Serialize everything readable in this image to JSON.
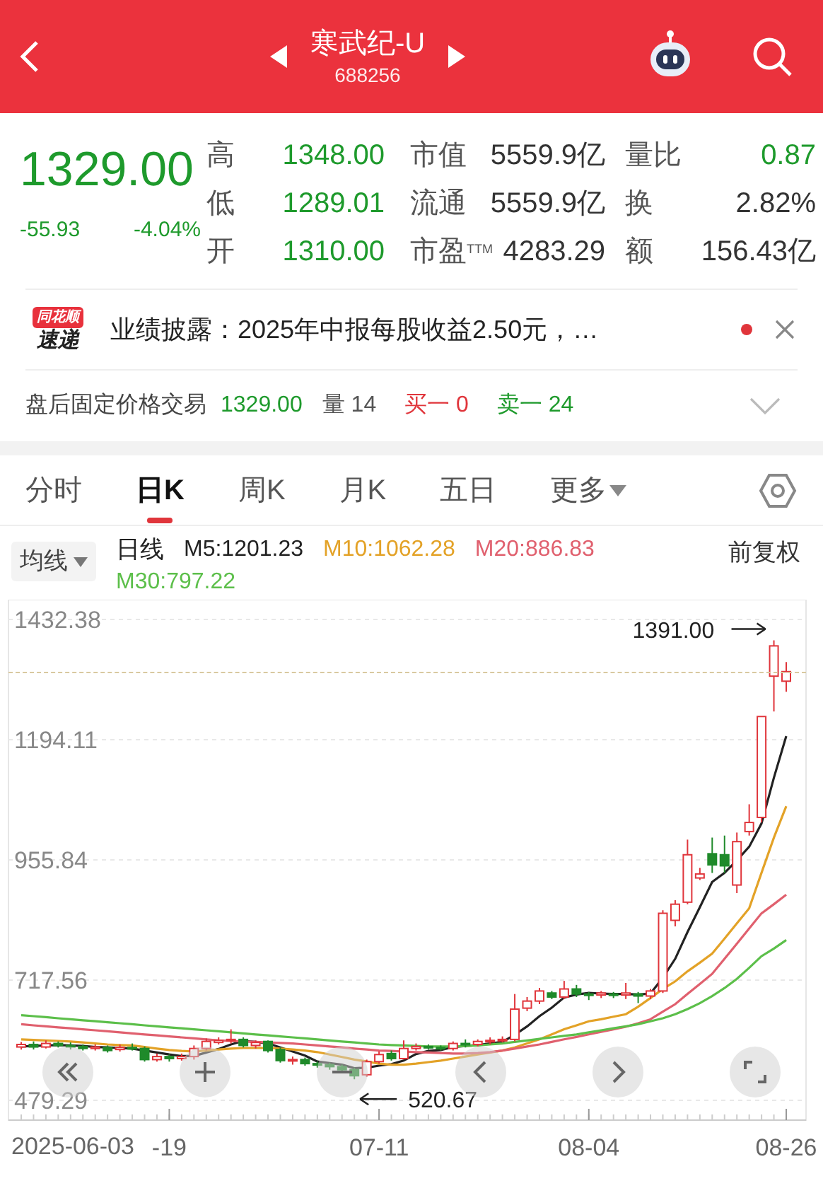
{
  "header": {
    "title": "寒武纪-U",
    "code": "688256"
  },
  "quote": {
    "price": "1329.00",
    "change": "-55.93",
    "change_pct": "-4.04%",
    "color": "#1e9a2c"
  },
  "stats": [
    [
      {
        "label": "高",
        "value": "1348.00",
        "color": "#1e9a2c"
      },
      {
        "label": "市值",
        "value": "5559.9亿",
        "color": "#333333"
      },
      {
        "label": "量比",
        "value": "0.87",
        "color": "#1e9a2c"
      }
    ],
    [
      {
        "label": "低",
        "value": "1289.01",
        "color": "#1e9a2c"
      },
      {
        "label": "流通",
        "value": "5559.9亿",
        "color": "#333333"
      },
      {
        "label": "换",
        "value": "2.82%",
        "color": "#333333"
      }
    ],
    [
      {
        "label": "开",
        "value": "1310.00",
        "color": "#1e9a2c"
      },
      {
        "label": "市盈$^{TTM}$",
        "value": "4283.29",
        "color": "#333333"
      },
      {
        "label": "额",
        "value": "156.43亿",
        "color": "#333333"
      }
    ]
  ],
  "news": {
    "source_top": "同花顺",
    "source_bottom": "速递",
    "text": "业绩披露：2025年中报每股收益2.50元，…",
    "unread": true
  },
  "after_hours": {
    "label": "盘后固定价格交易",
    "price": "1329.00",
    "volume_label": "量",
    "volume": "14",
    "bid_label": "买一",
    "bid": "0",
    "ask_label": "卖一",
    "ask": "24"
  },
  "tabs": [
    {
      "label": "分时",
      "selected": false,
      "kind": "tab"
    },
    {
      "label": "日K",
      "selected": true,
      "kind": "tab"
    },
    {
      "label": "周K",
      "selected": false,
      "kind": "tab"
    },
    {
      "label": "月K",
      "selected": false,
      "kind": "tab"
    },
    {
      "label": "五日",
      "selected": false,
      "kind": "tab"
    },
    {
      "label": "更多",
      "selected": false,
      "kind": "menu"
    }
  ],
  "chart_start_date": "2025-06-03",
  "legend": {
    "selector": "均线",
    "period": "日线",
    "items": [
      {
        "text": "M5:1201.23",
        "color": "#222222"
      },
      {
        "text": "M10:1062.28",
        "color": "#e3a227"
      },
      {
        "text": "M20:886.83",
        "color": "#e0606e"
      },
      {
        "text": "M30:797.22",
        "color": "#5cbf4a"
      }
    ],
    "adjust": "前复权"
  },
  "chart_data": {
    "type": "candlestick",
    "grid": true,
    "ylim": [
      479.29,
      1432.38
    ],
    "yticks": [
      1432.38,
      1194.11,
      955.84,
      717.56,
      479.29
    ],
    "categories": [
      null,
      null,
      null,
      null,
      null,
      null,
      null,
      null,
      null,
      null,
      null,
      null,
      "-19",
      null,
      null,
      null,
      null,
      null,
      null,
      null,
      null,
      null,
      null,
      null,
      null,
      null,
      null,
      null,
      null,
      "07-11",
      null,
      null,
      null,
      null,
      null,
      null,
      null,
      null,
      null,
      null,
      null,
      null,
      null,
      null,
      null,
      null,
      "08-04",
      null,
      null,
      null,
      null,
      null,
      null,
      null,
      null,
      null,
      null,
      null,
      null,
      null,
      null,
      null,
      "08-26"
    ],
    "ohlc": [
      [
        585,
        595,
        580,
        590
      ],
      [
        590,
        596,
        580,
        585
      ],
      [
        585,
        598,
        582,
        592
      ],
      [
        592,
        596,
        584,
        588
      ],
      [
        588,
        594,
        580,
        586
      ],
      [
        586,
        590,
        578,
        582
      ],
      [
        582,
        590,
        578,
        585
      ],
      [
        584,
        588,
        574,
        578
      ],
      [
        580,
        590,
        576,
        584
      ],
      [
        584,
        592,
        578,
        582
      ],
      [
        582,
        586,
        556,
        560
      ],
      [
        560,
        572,
        556,
        566
      ],
      [
        566,
        570,
        556,
        562
      ],
      [
        562,
        572,
        558,
        566
      ],
      [
        566,
        588,
        560,
        582
      ],
      [
        582,
        602,
        578,
        596
      ],
      [
        594,
        604,
        590,
        598
      ],
      [
        598,
        620,
        592,
        600
      ],
      [
        600,
        604,
        584,
        588
      ],
      [
        588,
        598,
        582,
        594
      ],
      [
        596,
        598,
        574,
        578
      ],
      [
        580,
        584,
        554,
        558
      ],
      [
        558,
        566,
        550,
        560
      ],
      [
        560,
        564,
        548,
        552
      ],
      [
        552,
        556,
        544,
        550
      ],
      [
        550,
        554,
        540,
        546
      ],
      [
        546,
        550,
        534,
        540
      ],
      [
        540,
        544,
        521,
        528
      ],
      [
        530,
        560,
        526,
        556
      ],
      [
        556,
        576,
        552,
        570
      ],
      [
        572,
        578,
        558,
        562
      ],
      [
        562,
        598,
        560,
        582
      ],
      [
        582,
        592,
        578,
        586
      ],
      [
        586,
        590,
        580,
        584
      ],
      [
        584,
        588,
        578,
        582
      ],
      [
        582,
        596,
        578,
        592
      ],
      [
        592,
        600,
        584,
        590
      ],
      [
        590,
        600,
        586,
        596
      ],
      [
        596,
        604,
        590,
        598
      ],
      [
        598,
        606,
        594,
        600
      ],
      [
        600,
        690,
        596,
        660
      ],
      [
        662,
        684,
        656,
        676
      ],
      [
        676,
        702,
        670,
        696
      ],
      [
        692,
        696,
        680,
        684
      ],
      [
        684,
        716,
        680,
        700
      ],
      [
        700,
        708,
        684,
        690
      ],
      [
        690,
        694,
        678,
        688
      ],
      [
        688,
        696,
        682,
        692
      ],
      [
        690,
        694,
        682,
        688
      ],
      [
        688,
        712,
        680,
        692
      ],
      [
        690,
        694,
        672,
        686
      ],
      [
        686,
        700,
        680,
        696
      ],
      [
        696,
        856,
        692,
        850
      ],
      [
        836,
        876,
        824,
        868
      ],
      [
        872,
        996,
        868,
        966
      ],
      [
        920,
        940,
        916,
        928
      ],
      [
        968,
        1000,
        930,
        946
      ],
      [
        966,
        1004,
        930,
        944
      ],
      [
        906,
        1010,
        890,
        992
      ],
      [
        1012,
        1066,
        1004,
        1030
      ],
      [
        1040,
        1240,
        1030,
        1240
      ],
      [
        1320,
        1391,
        1250,
        1380
      ],
      [
        1310,
        1348,
        1289,
        1329
      ]
    ],
    "series": [
      {
        "type": "line",
        "color": "#222222",
        "values": [
          586,
          587,
          588,
          589,
          588,
          587,
          585,
          584,
          583,
          582,
          578,
          574,
          570,
          567,
          567,
          574,
          581,
          590,
          597,
          595,
          592,
          584,
          576,
          568,
          556,
          553,
          550,
          543,
          544,
          548,
          551,
          558,
          571,
          577,
          579,
          585,
          587,
          589,
          592,
          595,
          609,
          626,
          646,
          663,
          683,
          689,
          692,
          691,
          690,
          690,
          689,
          691,
          722,
          760,
          813,
          862,
          912,
          930,
          955,
          982,
          1028,
          1119,
          1201
        ]
      },
      {
        "type": "line",
        "color": "#e3a227",
        "values": [
          600,
          599,
          598,
          597,
          596,
          594,
          592,
          590,
          589,
          588,
          585,
          582,
          579,
          577,
          576,
          578,
          580,
          582,
          583,
          583,
          583,
          582,
          580,
          578,
          575,
          570,
          565,
          560,
          556,
          552,
          550,
          550,
          552,
          555,
          558,
          562,
          566,
          570,
          574,
          578,
          584,
          592,
          600,
          610,
          620,
          628,
          636,
          640,
          645,
          650,
          665,
          682,
          700,
          715,
          735,
          752,
          770,
          800,
          830,
          860,
          930,
          1000,
          1062
        ]
      },
      {
        "type": "line",
        "color": "#e0606e",
        "values": [
          630,
          628,
          626,
          624,
          622,
          620,
          618,
          616,
          614,
          612,
          610,
          608,
          606,
          604,
          602,
          600,
          598,
          597,
          596,
          595,
          594,
          593,
          592,
          590,
          588,
          586,
          584,
          582,
          580,
          578,
          577,
          576,
          575,
          574,
          573,
          572,
          572,
          573,
          575,
          578,
          582,
          586,
          590,
          595,
          600,
          605,
          610,
          615,
          620,
          625,
          632,
          640,
          655,
          670,
          690,
          710,
          730,
          760,
          790,
          820,
          850,
          868,
          887
        ]
      },
      {
        "type": "line",
        "color": "#5cbf4a",
        "values": [
          648,
          646,
          644,
          642,
          640,
          638,
          636,
          634,
          632,
          630,
          628,
          626,
          624,
          622,
          620,
          618,
          616,
          614,
          612,
          610,
          608,
          606,
          604,
          602,
          600,
          598,
          596,
          594,
          592,
          590,
          589,
          588,
          587,
          586,
          586,
          586,
          587,
          588,
          590,
          592,
          595,
          598,
          601,
          604,
          607,
          610,
          614,
          618,
          622,
          626,
          630,
          636,
          642,
          650,
          660,
          672,
          686,
          702,
          720,
          742,
          765,
          780,
          797
        ]
      }
    ],
    "annotations": [
      "1391.00",
      "520.67"
    ]
  }
}
